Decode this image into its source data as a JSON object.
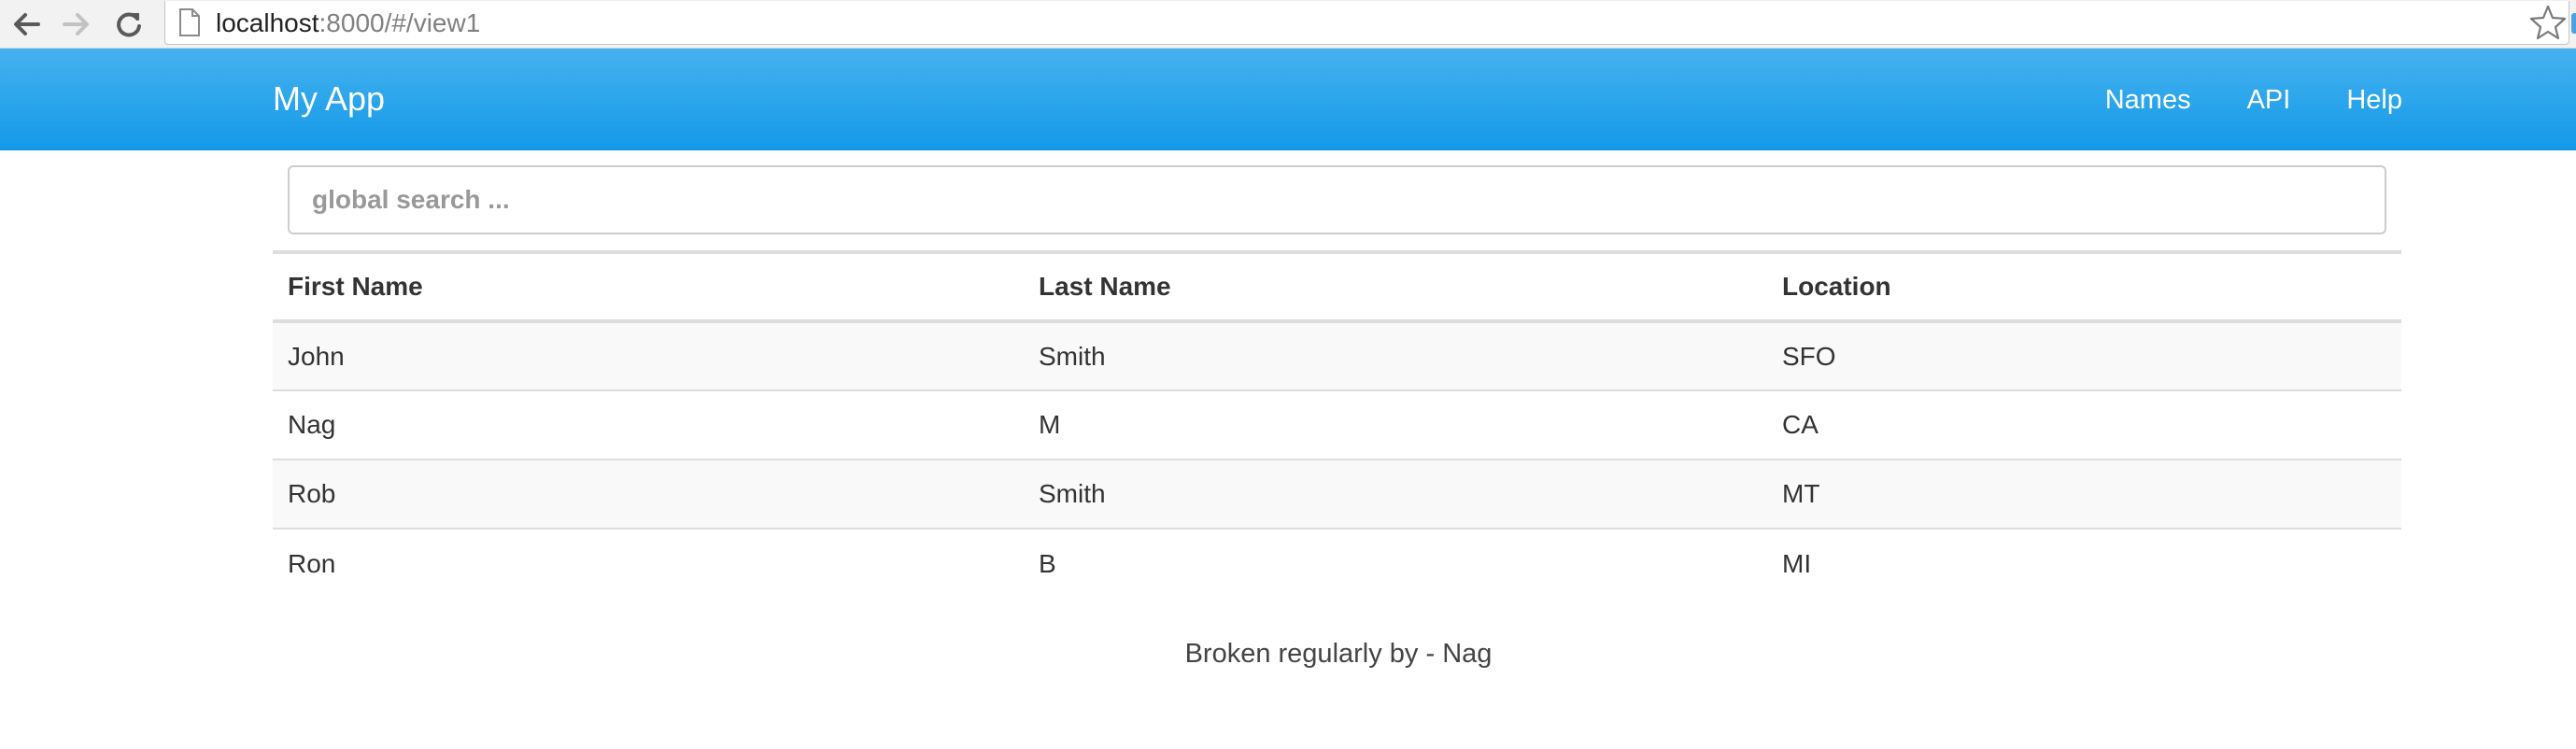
{
  "browser": {
    "url_host": "localhost",
    "url_rest": ":8000/#/view1",
    "icons": {
      "back": "back-arrow-icon",
      "forward": "forward-arrow-icon",
      "reload": "reload-icon",
      "page": "page-icon",
      "bookmark": "star-icon"
    }
  },
  "navbar": {
    "brand": "My App",
    "links": [
      {
        "label": "Names"
      },
      {
        "label": "API"
      },
      {
        "label": "Help"
      }
    ],
    "colors": {
      "gradient_top": "#45b2ef",
      "gradient_bottom": "#1499e8",
      "text": "#ffffff"
    }
  },
  "search": {
    "placeholder": "global search ...",
    "value": ""
  },
  "table": {
    "columns": [
      "First Name",
      "Last Name",
      "Location"
    ],
    "rows": [
      {
        "first": "John",
        "last": "Smith",
        "location": "SFO"
      },
      {
        "first": "Nag",
        "last": "M",
        "location": "CA"
      },
      {
        "first": "Rob",
        "last": "Smith",
        "location": "MT"
      },
      {
        "first": "Ron",
        "last": "B",
        "location": "MI"
      }
    ]
  },
  "footer": {
    "text": "Broken regularly by - Nag"
  }
}
